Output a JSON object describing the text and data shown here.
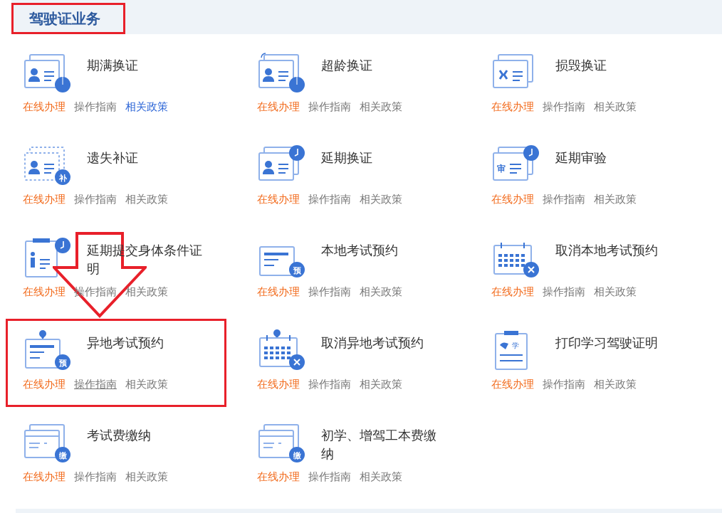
{
  "section": {
    "title": "驾驶证业务",
    "highlighted": true
  },
  "items": [
    {
      "title": "期满换证",
      "icon": {
        "kind": "card",
        "badge": {
          "kind": "pie"
        }
      },
      "highlighted": false,
      "links": [
        {
          "label": "在线办理",
          "kind": "online",
          "hovered": false
        },
        {
          "label": "操作指南",
          "kind": "guide",
          "active": false,
          "hovered": false
        },
        {
          "label": "相关政策",
          "kind": "policy",
          "active": true,
          "hovered": false
        }
      ]
    },
    {
      "title": "超龄换证",
      "icon": {
        "kind": "card-refresh",
        "badge": {
          "kind": "pie"
        }
      },
      "highlighted": false,
      "links": [
        {
          "label": "在线办理",
          "kind": "online",
          "hovered": false
        },
        {
          "label": "操作指南",
          "kind": "guide",
          "active": false,
          "hovered": false
        },
        {
          "label": "相关政策",
          "kind": "policy",
          "active": false,
          "hovered": false
        }
      ]
    },
    {
      "title": "损毁换证",
      "icon": {
        "kind": "card-torn"
      },
      "highlighted": false,
      "links": [
        {
          "label": "在线办理",
          "kind": "online",
          "hovered": false
        },
        {
          "label": "操作指南",
          "kind": "guide",
          "active": false,
          "hovered": false
        },
        {
          "label": "相关政策",
          "kind": "policy",
          "active": false,
          "hovered": false
        }
      ]
    },
    {
      "title": "遗失补证",
      "icon": {
        "kind": "card-dotted",
        "badge": {
          "kind": "text",
          "text": "补"
        }
      },
      "highlighted": false,
      "links": [
        {
          "label": "在线办理",
          "kind": "online",
          "hovered": false
        },
        {
          "label": "操作指南",
          "kind": "guide",
          "active": false,
          "hovered": false
        },
        {
          "label": "相关政策",
          "kind": "policy",
          "active": false,
          "hovered": false
        }
      ]
    },
    {
      "title": "延期换证",
      "icon": {
        "kind": "card",
        "badge": {
          "kind": "clock"
        }
      },
      "highlighted": false,
      "links": [
        {
          "label": "在线办理",
          "kind": "online",
          "hovered": false
        },
        {
          "label": "操作指南",
          "kind": "guide",
          "active": false,
          "hovered": false
        },
        {
          "label": "相关政策",
          "kind": "policy",
          "active": false,
          "hovered": false
        }
      ]
    },
    {
      "title": "延期审验",
      "icon": {
        "kind": "card-mark",
        "mark": "审",
        "badge": {
          "kind": "clock"
        }
      },
      "highlighted": false,
      "links": [
        {
          "label": "在线办理",
          "kind": "online",
          "hovered": false
        },
        {
          "label": "操作指南",
          "kind": "guide",
          "active": false,
          "hovered": false
        },
        {
          "label": "相关政策",
          "kind": "policy",
          "active": false,
          "hovered": false
        }
      ]
    },
    {
      "title": "延期提交身体条件证明",
      "icon": {
        "kind": "clipboard-person",
        "badge": {
          "kind": "clock"
        }
      },
      "highlighted": false,
      "links": [
        {
          "label": "在线办理",
          "kind": "online",
          "hovered": false
        },
        {
          "label": "操作指南",
          "kind": "guide",
          "active": false,
          "hovered": false
        },
        {
          "label": "相关政策",
          "kind": "policy",
          "active": false,
          "hovered": false
        }
      ]
    },
    {
      "title": "本地考试预约",
      "icon": {
        "kind": "form",
        "badge": {
          "kind": "text",
          "text": "预"
        }
      },
      "highlighted": false,
      "links": [
        {
          "label": "在线办理",
          "kind": "online",
          "hovered": false
        },
        {
          "label": "操作指南",
          "kind": "guide",
          "active": false,
          "hovered": false
        },
        {
          "label": "相关政策",
          "kind": "policy",
          "active": false,
          "hovered": false
        }
      ]
    },
    {
      "title": "取消本地考试预约",
      "icon": {
        "kind": "calendar",
        "badge": {
          "kind": "cross"
        }
      },
      "highlighted": false,
      "links": [
        {
          "label": "在线办理",
          "kind": "online",
          "hovered": false
        },
        {
          "label": "操作指南",
          "kind": "guide",
          "active": false,
          "hovered": false
        },
        {
          "label": "相关政策",
          "kind": "policy",
          "active": false,
          "hovered": false
        }
      ]
    },
    {
      "title": "异地考试预约",
      "icon": {
        "kind": "form-pin",
        "badge": {
          "kind": "text",
          "text": "预"
        }
      },
      "highlighted": true,
      "links": [
        {
          "label": "在线办理",
          "kind": "online",
          "hovered": false
        },
        {
          "label": "操作指南",
          "kind": "guide",
          "active": false,
          "hovered": true
        },
        {
          "label": "相关政策",
          "kind": "policy",
          "active": false,
          "hovered": false
        }
      ]
    },
    {
      "title": "取消异地考试预约",
      "icon": {
        "kind": "calendar-pin",
        "badge": {
          "kind": "cross"
        }
      },
      "highlighted": false,
      "links": [
        {
          "label": "在线办理",
          "kind": "online",
          "hovered": false
        },
        {
          "label": "操作指南",
          "kind": "guide",
          "active": false,
          "hovered": false
        },
        {
          "label": "相关政策",
          "kind": "policy",
          "active": false,
          "hovered": false
        }
      ]
    },
    {
      "title": "打印学习驾驶证明",
      "icon": {
        "kind": "clipboard-mark",
        "mark": "学"
      },
      "highlighted": false,
      "links": [
        {
          "label": "在线办理",
          "kind": "online",
          "hovered": false
        },
        {
          "label": "操作指南",
          "kind": "guide",
          "active": false,
          "hovered": false
        },
        {
          "label": "相关政策",
          "kind": "policy",
          "active": false,
          "hovered": false
        }
      ]
    },
    {
      "title": "考试费缴纳",
      "icon": {
        "kind": "card-lines",
        "badge": {
          "kind": "text",
          "text": "缴"
        }
      },
      "highlighted": false,
      "links": [
        {
          "label": "在线办理",
          "kind": "online",
          "hovered": false
        },
        {
          "label": "操作指南",
          "kind": "guide",
          "active": false,
          "hovered": false
        },
        {
          "label": "相关政策",
          "kind": "policy",
          "active": false,
          "hovered": false
        }
      ]
    },
    {
      "title": "初学、增驾工本费缴纳",
      "icon": {
        "kind": "card-lines",
        "badge": {
          "kind": "text",
          "text": "缴"
        }
      },
      "highlighted": false,
      "links": [
        {
          "label": "在线办理",
          "kind": "online",
          "hovered": false
        },
        {
          "label": "操作指南",
          "kind": "guide",
          "active": false,
          "hovered": false
        },
        {
          "label": "相关政策",
          "kind": "policy",
          "active": false,
          "hovered": false
        }
      ]
    }
  ],
  "annotation": {
    "kind": "down-arrow"
  }
}
